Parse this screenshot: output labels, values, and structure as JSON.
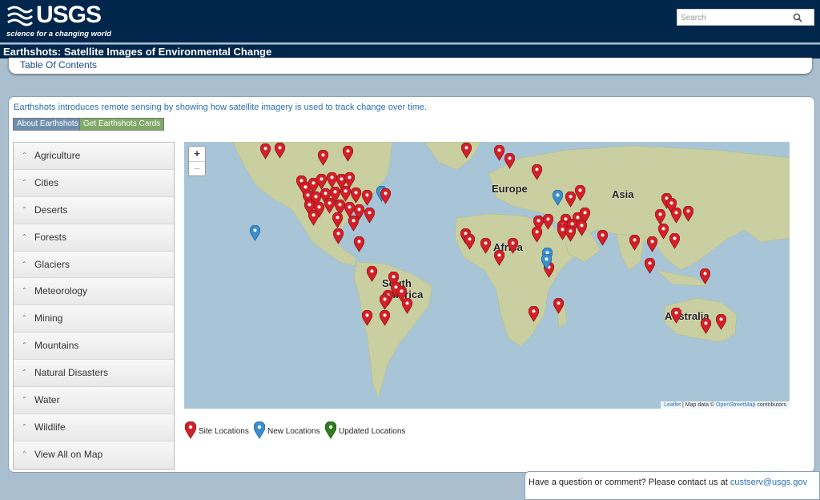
{
  "header": {
    "logo_text": "USGS",
    "tagline": "science for a changing world",
    "search_placeholder": "Search"
  },
  "title": "Earthshots: Satellite Images of Environmental Change",
  "toc_label": "Table Of Contents",
  "intro": "Earthshots introduces remote sensing by showing how satellite imagery is used to track change over time.",
  "buttons": {
    "about": "About Earthshots",
    "cards": "Get Earthshots Cards"
  },
  "sidebar": {
    "items": [
      {
        "label": "Agriculture"
      },
      {
        "label": "Cities"
      },
      {
        "label": "Deserts"
      },
      {
        "label": "Forests"
      },
      {
        "label": "Glaciers"
      },
      {
        "label": "Meteorology"
      },
      {
        "label": "Mining"
      },
      {
        "label": "Mountains"
      },
      {
        "label": "Natural Disasters"
      },
      {
        "label": "Water"
      },
      {
        "label": "Wildlife"
      },
      {
        "label": "View All on Map"
      }
    ]
  },
  "map": {
    "zoom_in": "+",
    "zoom_out": "−",
    "labels": {
      "europe": "Europe",
      "asia": "Asia",
      "africa": "Africa",
      "south_america": "South America",
      "australia": "Australia"
    },
    "attribution": {
      "leaflet": "Leaflet",
      "sep": " | Map data © ",
      "osm": "OpenStreetMap",
      "contributors": " contributors"
    }
  },
  "legend": {
    "site": "Site Locations",
    "new": "New Locations",
    "updated": "Updated Locations"
  },
  "colors": {
    "site": "#d42027",
    "new": "#3a8fd0",
    "updated": "#2e7d1e"
  },
  "footer": {
    "text": "Have a question or comment? Please contact us at ",
    "email": "custserv@usgs.gov"
  }
}
